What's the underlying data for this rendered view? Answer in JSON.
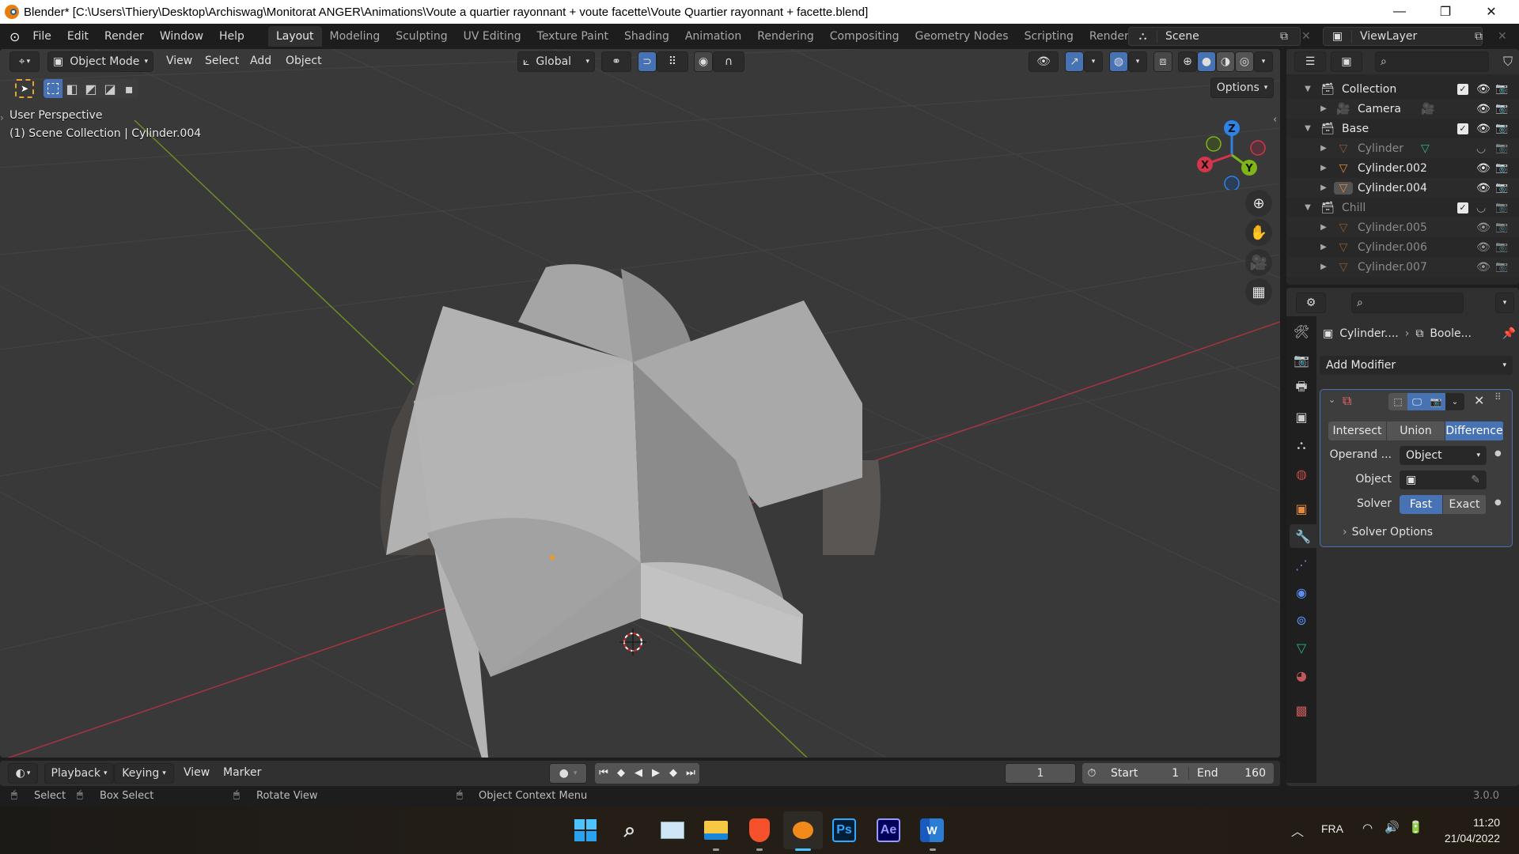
{
  "window": {
    "title": "Blender* [C:\\Users\\Thiery\\Desktop\\Archiswag\\Monitorat ANGER\\Animations\\Voute a quartier rayonnant + voute facette\\Voute Quartier rayonnant + facette.blend]",
    "controls": {
      "minimize": "—",
      "maximize": "❐",
      "close": "✕"
    }
  },
  "topbar": {
    "menus": [
      "File",
      "Edit",
      "Render",
      "Window",
      "Help"
    ],
    "workspaces": [
      "Layout",
      "Modeling",
      "Sculpting",
      "UV Editing",
      "Texture Paint",
      "Shading",
      "Animation",
      "Rendering",
      "Compositing",
      "Geometry Nodes",
      "Scripting",
      "Rendering.("
    ],
    "active_workspace": "Layout",
    "scene": "Scene",
    "view_layer": "ViewLayer"
  },
  "viewport": {
    "mode": "Object Mode",
    "menus": [
      "View",
      "Select",
      "Add",
      "Object"
    ],
    "orientation": "Global",
    "options_label": "Options",
    "perspective_label": "User Perspective",
    "collection_label": "(1) Scene Collection | Cylinder.004",
    "gizmo": {
      "x": "X",
      "y": "Y",
      "z": "Z"
    },
    "colors": {
      "x_axis": "#d3364b",
      "y_axis": "#7fb518",
      "z_axis": "#2e83e8",
      "background": "#393939",
      "active_blue": "#4772b3"
    }
  },
  "outliner": {
    "rows": [
      {
        "name": "Collection",
        "type": "collection",
        "depth": 0,
        "expanded": true,
        "checked": true,
        "visible": true,
        "dim": false
      },
      {
        "name": "Camera",
        "type": "camera",
        "depth": 1,
        "expanded": false,
        "visible": true,
        "dim": false,
        "extra": "camera-data"
      },
      {
        "name": "Base",
        "type": "collection",
        "depth": 0,
        "expanded": true,
        "checked": true,
        "visible": true,
        "dim": false
      },
      {
        "name": "Cylinder",
        "type": "mesh",
        "depth": 1,
        "expanded": false,
        "visible": false,
        "dim": true,
        "extra": "mesh-data"
      },
      {
        "name": "Cylinder.002",
        "type": "mesh",
        "depth": 1,
        "expanded": false,
        "visible": true,
        "dim": false
      },
      {
        "name": "Cylinder.004",
        "type": "mesh",
        "depth": 1,
        "expanded": false,
        "visible": true,
        "dim": false,
        "active": true
      },
      {
        "name": "Chill",
        "type": "collection",
        "depth": 0,
        "expanded": true,
        "checked": true,
        "visible": false,
        "dim": true
      },
      {
        "name": "Cylinder.005",
        "type": "mesh",
        "depth": 1,
        "expanded": false,
        "visible": true,
        "dim": true
      },
      {
        "name": "Cylinder.006",
        "type": "mesh",
        "depth": 1,
        "expanded": false,
        "visible": true,
        "dim": true
      },
      {
        "name": "Cylinder.007",
        "type": "mesh",
        "depth": 1,
        "expanded": false,
        "visible": true,
        "dim": true
      }
    ]
  },
  "properties": {
    "breadcrumb_object": "Cylinder....",
    "breadcrumb_modifier": "Boole...",
    "add_modifier": "Add Modifier",
    "boolean": {
      "operations": [
        "Intersect",
        "Union",
        "Difference"
      ],
      "active_operation": "Difference",
      "operand_label": "Operand ...",
      "operand_value": "Object",
      "object_label": "Object",
      "object_value": "",
      "solver_label": "Solver",
      "solvers": [
        "Fast",
        "Exact"
      ],
      "active_solver": "Fast",
      "solver_options": "Solver Options"
    }
  },
  "timeline": {
    "menus": [
      "Playback",
      "Keying",
      "View",
      "Marker"
    ],
    "current_frame": "1",
    "start_label": "Start",
    "start": "1",
    "end_label": "End",
    "end": "160"
  },
  "statusbar": {
    "hints": [
      "Select",
      "Box Select",
      "Rotate View",
      "Object Context Menu"
    ],
    "version": "3.0.0"
  },
  "taskbar": {
    "apps": [
      "Start",
      "Search",
      "Resource Monitor",
      "File Explorer",
      "Brave",
      "Blender",
      "Photoshop",
      "After Effects",
      "Word"
    ],
    "ps_label": "Ps",
    "ae_label": "Ae",
    "word_label": "W",
    "language": "FRA",
    "time": "11:20",
    "date": "21/04/2022"
  }
}
